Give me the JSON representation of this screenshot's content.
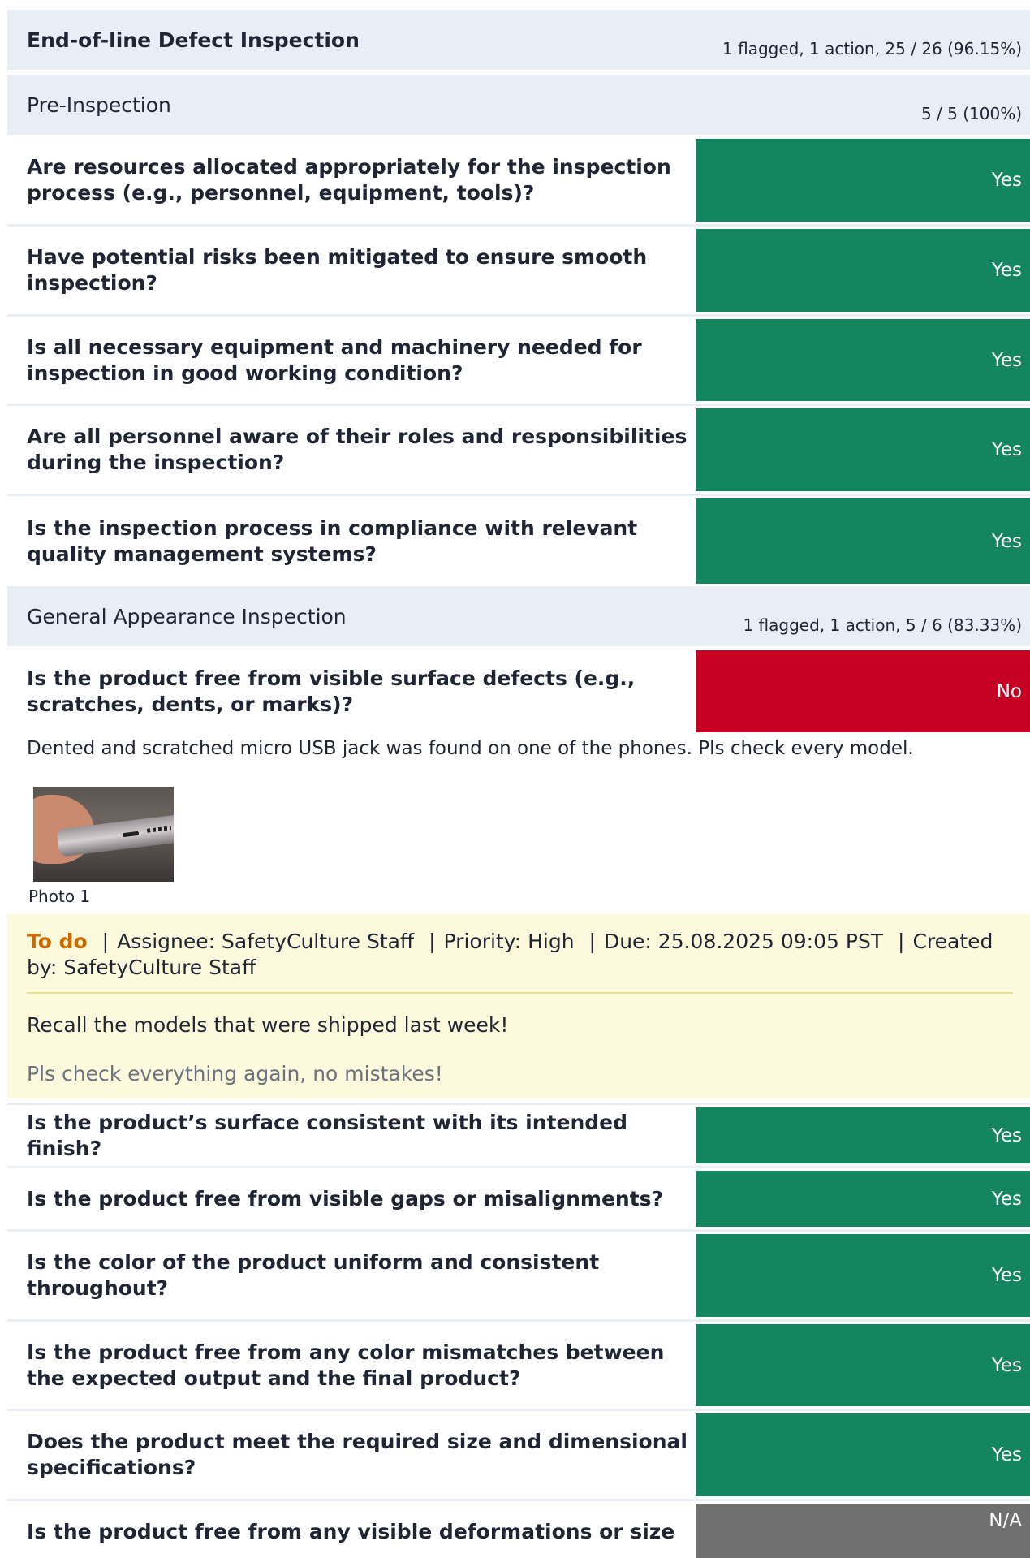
{
  "header": {
    "title": "End-of-line Defect Inspection",
    "stats": "1 flagged, 1 action, 25 / 26 (96.15%)"
  },
  "pre_inspection": {
    "title": "Pre-Inspection",
    "stats": "5 / 5 (100%)",
    "questions": [
      {
        "text": "Are resources allocated appropriately for the inspection process (e.g., personnel, equipment, tools)?",
        "answer": "Yes"
      },
      {
        "text": "Have potential risks been mitigated to ensure smooth inspection?",
        "answer": "Yes"
      },
      {
        "text": "Is all necessary equipment and machinery needed for inspection in good working condition?",
        "answer": "Yes"
      },
      {
        "text": "Are all personnel aware of their roles and responsibilities during the inspection?",
        "answer": "Yes"
      },
      {
        "text": "Is the inspection process in compliance with relevant quality management systems?",
        "answer": "Yes"
      }
    ]
  },
  "general_appearance": {
    "title": "General Appearance Inspection",
    "stats": "1 flagged, 1 action, 5 / 6 (83.33%)",
    "flagged_question": {
      "text": "Is the product free from visible surface defects (e.g., scratches, dents, or marks)?",
      "answer": "No",
      "note": "Dented and scratched micro USB jack was found on one of the phones. Pls check every model.",
      "photo_caption": "Photo 1"
    },
    "action": {
      "status": "To do",
      "assignee": "Assignee: SafetyCulture Staff",
      "priority": "Priority: High",
      "due": "Due: 25.08.2025 09:05 PST",
      "created_by": "Created by: SafetyCulture Staff",
      "separator": "|",
      "title": "Recall the models that were shipped last week!",
      "description": "Pls check everything again, no mistakes!"
    },
    "questions": [
      {
        "text": "Is the product’s surface consistent with its intended finish?",
        "answer": "Yes"
      },
      {
        "text": "Is the product free from visible gaps or misalignments?",
        "answer": "Yes"
      },
      {
        "text": "Is the color of the product uniform and consistent throughout?",
        "answer": "Yes"
      },
      {
        "text": "Is the product free from any color mismatches between the expected output and the final product?",
        "answer": "Yes"
      },
      {
        "text": "Does the product meet the required size and dimensional specifications?",
        "answer": "Yes"
      },
      {
        "text": "Is the product free from any visible deformations or size",
        "answer": "N/A"
      }
    ]
  },
  "colors": {
    "yes": "#13855f",
    "no": "#c60022",
    "na": "#707070",
    "section_bg": "#e9edf6",
    "action_bg": "#fdf9dc",
    "status_todo": "#c96b00"
  }
}
